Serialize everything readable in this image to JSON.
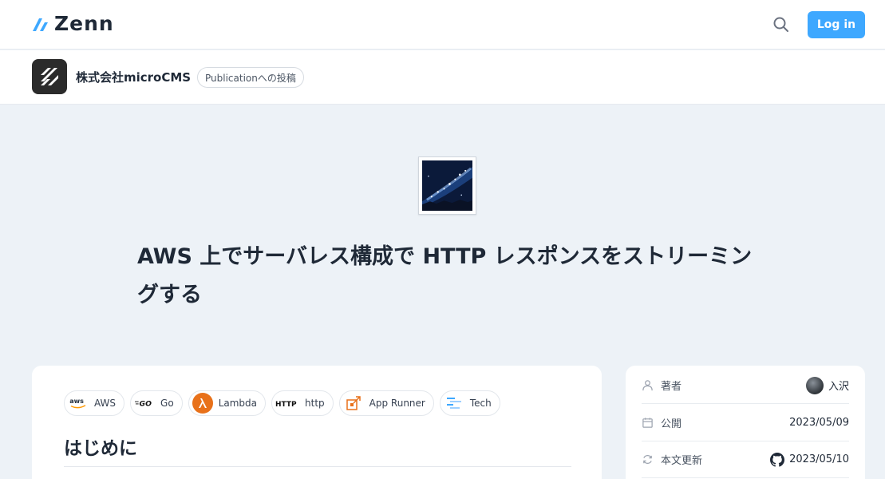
{
  "header": {
    "logo_text": "Zenn",
    "search_icon": "search-icon",
    "login_label": "Log in",
    "accent_color": "#3ea8ff"
  },
  "publication": {
    "name": "株式会社microCMS",
    "badge": "Publicationへの投稿"
  },
  "article": {
    "emoji": "milky-way",
    "title_line1": "AWS 上でサーバレス構成で HTTP レスポンスをストリーミン",
    "title_line2": "グする",
    "tags": [
      {
        "label": "AWS",
        "icon": "aws-icon"
      },
      {
        "label": "Go",
        "icon": "go-icon"
      },
      {
        "label": "Lambda",
        "icon": "lambda-icon"
      },
      {
        "label": "http",
        "icon": "http-icon"
      },
      {
        "label": "App Runner",
        "icon": "app-runner-icon"
      },
      {
        "label": "Tech",
        "icon": "tech-icon"
      }
    ],
    "first_heading": "はじめに"
  },
  "sidebar": {
    "author_label": "著者",
    "author_name": "入沢",
    "published_label": "公開",
    "published_date": "2023/05/09",
    "updated_label": "本文更新",
    "updated_date": "2023/05/10"
  }
}
